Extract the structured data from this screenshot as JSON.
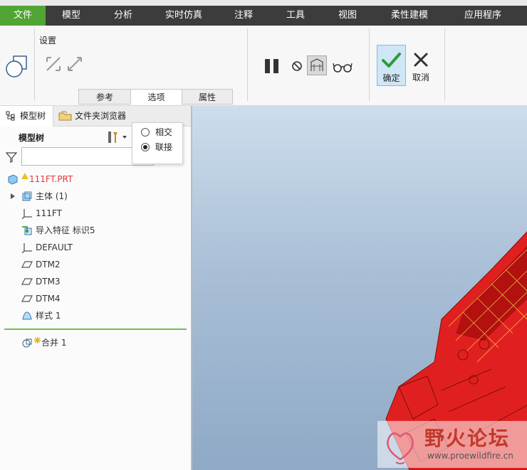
{
  "menubar": {
    "items": [
      {
        "label": "文件",
        "active": true
      },
      {
        "label": "模型"
      },
      {
        "label": "分析"
      },
      {
        "label": "实时仿真"
      },
      {
        "label": "注释"
      },
      {
        "label": "工具"
      },
      {
        "label": "视图"
      },
      {
        "label": "柔性建模"
      },
      {
        "label": "应用程序"
      }
    ]
  },
  "ribbon": {
    "settings_label": "设置",
    "subtabs": [
      "参考",
      "选项",
      "属性"
    ],
    "active_subtab": "选项",
    "ok_label": "确定",
    "cancel_label": "取消"
  },
  "options_popup": {
    "options": [
      "相交",
      "联接"
    ],
    "selected": "联接"
  },
  "side_panel": {
    "tabs": [
      "模型树",
      "文件夹浏览器"
    ],
    "header": "模型树",
    "search_value": "",
    "tree": [
      {
        "label": "111FT.PRT",
        "icon": "part-icon",
        "color": "#e03a3a"
      },
      {
        "label": "主体 (1)",
        "icon": "body-icon"
      },
      {
        "label": "111FT",
        "icon": "coordinate-system-icon"
      },
      {
        "label": "导入特征 标识5",
        "icon": "import-feature-icon"
      },
      {
        "label": "DEFAULT",
        "icon": "coordinate-system-icon"
      },
      {
        "label": "DTM2",
        "icon": "datum-plane-icon"
      },
      {
        "label": "DTM3",
        "icon": "datum-plane-icon"
      },
      {
        "label": "DTM4",
        "icon": "datum-plane-icon"
      },
      {
        "label": "样式 1",
        "icon": "style-icon"
      },
      {
        "label": "合并 1",
        "icon": "merge-icon"
      }
    ]
  },
  "watermark": {
    "text": "野火论坛",
    "url": "www.proewildfire.cn"
  },
  "colors": {
    "menubar_bg": "#3c3c3c",
    "active_menu": "#52a535",
    "model_red": "#e02020",
    "insert_line": "#6cc24a"
  }
}
